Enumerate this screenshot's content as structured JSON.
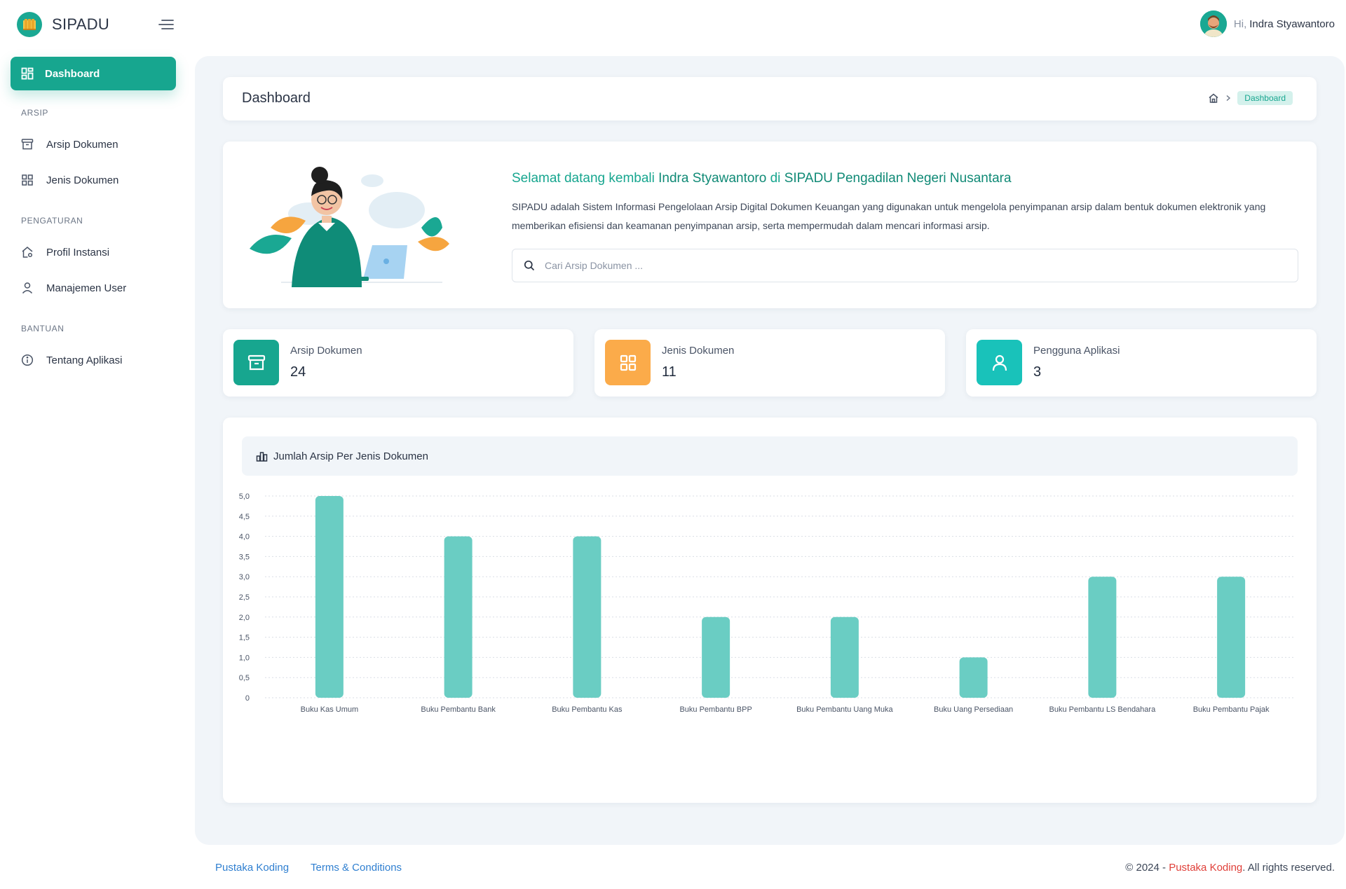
{
  "app": {
    "name": "SIPADU"
  },
  "user": {
    "greeting": "Hi,",
    "name": "Indra Styawantoro"
  },
  "sidebar": {
    "active": {
      "label": "Dashboard"
    },
    "sections": [
      {
        "title": "ARSIP",
        "items": [
          {
            "label": "Arsip Dokumen",
            "icon": "archive-icon"
          },
          {
            "label": "Jenis Dokumen",
            "icon": "grid-icon"
          }
        ]
      },
      {
        "title": "PENGATURAN",
        "items": [
          {
            "label": "Profil Instansi",
            "icon": "home-settings-icon"
          },
          {
            "label": "Manajemen User",
            "icon": "user-icon"
          }
        ]
      },
      {
        "title": "BANTUAN",
        "items": [
          {
            "label": "Tentang Aplikasi",
            "icon": "info-icon"
          }
        ]
      }
    ]
  },
  "page": {
    "title": "Dashboard",
    "breadcrumb": "Dashboard"
  },
  "welcome": {
    "prefix": "Selamat datang kembali ",
    "user": "Indra Styawantoro",
    "middle": " di ",
    "app": "SIPADU Pengadilan Negeri Nusantara",
    "description": "SIPADU adalah Sistem Informasi Pengelolaan Arsip Digital Dokumen Keuangan yang digunakan untuk mengelola penyimpanan arsip dalam bentuk dokumen elektronik yang memberikan efisiensi dan keamanan penyimpanan arsip, serta mempermudah dalam mencari informasi arsip.",
    "search_placeholder": "Cari Arsip Dokumen ..."
  },
  "stats": [
    {
      "label": "Arsip Dokumen",
      "value": "24",
      "color": "#17a68f",
      "icon": "archive-icon"
    },
    {
      "label": "Jenis Dokumen",
      "value": "11",
      "color": "#fbab4a",
      "icon": "grid-icon"
    },
    {
      "label": "Pengguna Aplikasi",
      "value": "3",
      "color": "#19c2ba",
      "icon": "user-icon"
    }
  ],
  "chart_title": "Jumlah Arsip Per Jenis Dokumen",
  "chart_data": {
    "type": "bar",
    "title": "Jumlah Arsip Per Jenis Dokumen",
    "categories": [
      "Buku Kas Umum",
      "Buku Pembantu Bank",
      "Buku Pembantu Kas",
      "Buku Pembantu BPP",
      "Buku Pembantu Uang Muka",
      "Buku Uang Persediaan",
      "Buku Pembantu LS Bendahara",
      "Buku Pembantu Pajak"
    ],
    "values": [
      5,
      4,
      4,
      2,
      2,
      1,
      3,
      3
    ],
    "yticks": [
      "0",
      "0,5",
      "1,0",
      "1,5",
      "2,0",
      "2,5",
      "3,0",
      "3,5",
      "4,0",
      "4,5",
      "5,0"
    ],
    "ylim": [
      0,
      5
    ],
    "color": "#6acdc3",
    "grid": true
  },
  "footer": {
    "links": [
      "Pustaka Koding",
      "Terms & Conditions"
    ],
    "copyright_prefix": "© 2024 - ",
    "copyright_brand": "Pustaka Koding",
    "copyright_suffix": ". All rights reserved."
  }
}
